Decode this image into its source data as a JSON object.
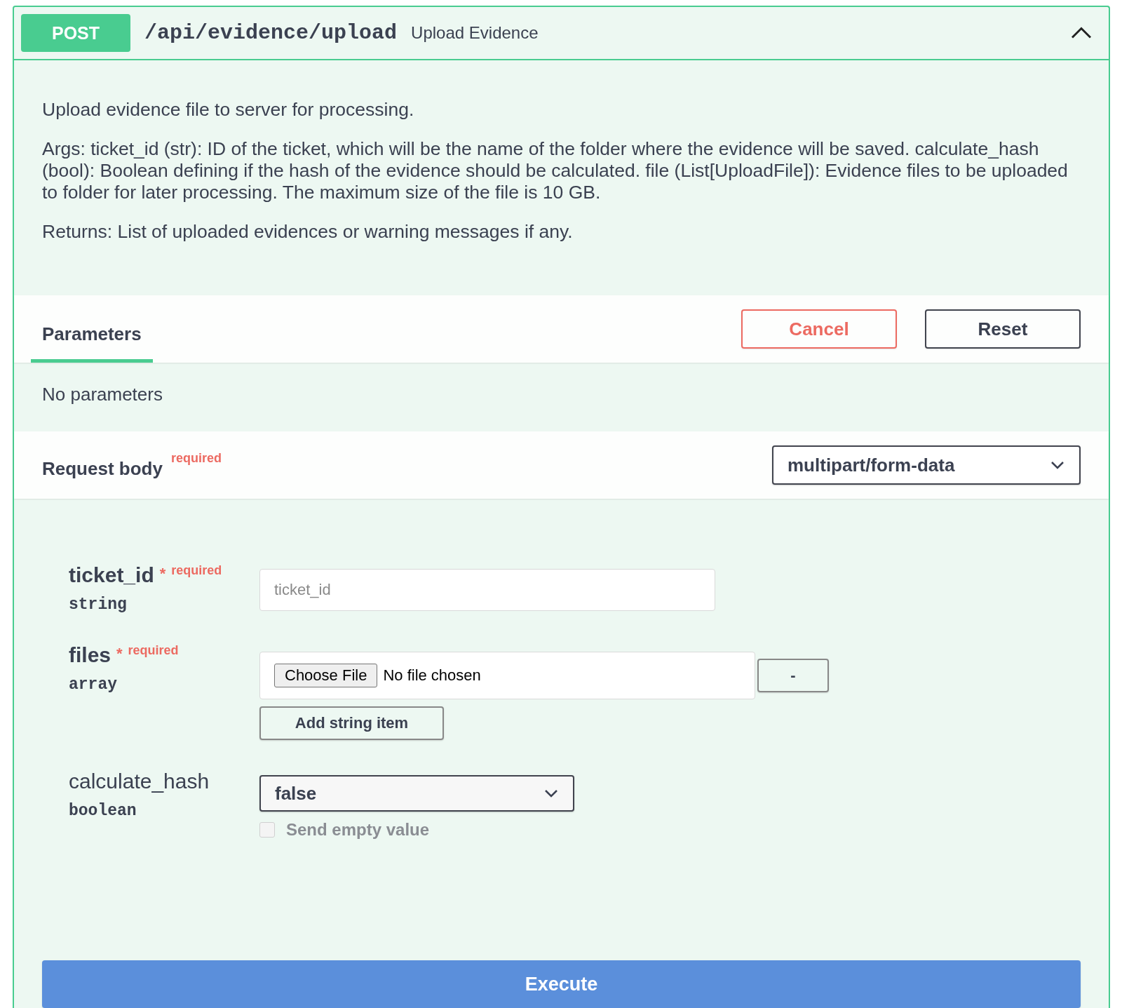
{
  "operation": {
    "method": "POST",
    "path": "/api/evidence/upload",
    "summary": "Upload Evidence",
    "expanded": true
  },
  "description": [
    "Upload evidence file to server for processing.",
    "Args: ticket_id (str): ID of the ticket, which will be the name of the folder where the evidence will be saved. calculate_hash (bool): Boolean defining if the hash of the evidence should be calculated. file (List[UploadFile]): Evidence files to be uploaded to folder for later processing. The maximum size of the file is 10 GB.",
    "Returns: List of uploaded evidences or warning messages if any."
  ],
  "parameters_section": {
    "tab": {
      "label": "Parameters",
      "selected": true
    },
    "buttons": [
      {
        "label": "Cancel",
        "kind": "cancel"
      },
      {
        "label": "Reset",
        "kind": "reset"
      }
    ],
    "empty_message": "No parameters"
  },
  "request_body": {
    "title": "Request body",
    "required_label": "required",
    "content_type": "multipart/form-data"
  },
  "fields": [
    {
      "kind": "text",
      "name": "ticket_id",
      "required": true,
      "required_mark": "*",
      "required_label": "required",
      "type": "string",
      "placeholder": "ticket_id"
    },
    {
      "kind": "files",
      "name": "files",
      "required": true,
      "required_mark": "*",
      "required_label": "required",
      "type": "array",
      "choose_label": "Choose File",
      "file_status": "No file chosen",
      "remove_label": "-",
      "add_label": "Add string item"
    },
    {
      "kind": "select",
      "name": "calculate_hash",
      "required": false,
      "type": "boolean",
      "value": "false",
      "send_empty": {
        "label": "Send empty value",
        "checked": false
      }
    }
  ],
  "execute": {
    "label": "Execute"
  }
}
